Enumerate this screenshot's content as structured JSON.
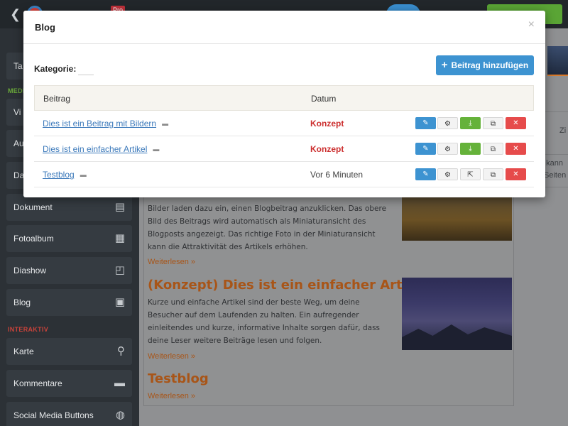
{
  "modal": {
    "title": "Blog",
    "close_glyph": "×",
    "category_label": "Kategorie:",
    "add_button": {
      "icon": "plus-icon",
      "label": "Beitrag hinzufügen"
    },
    "table": {
      "headers": [
        "Beitrag",
        "Datum"
      ],
      "rows": [
        {
          "title": "Dies ist ein Beitrag mit Bildern",
          "date": "Konzept",
          "status": "draft",
          "third_action": "publish-icon"
        },
        {
          "title": "Dies ist ein einfacher Artikel",
          "date": "Konzept",
          "status": "draft",
          "third_action": "publish-icon"
        },
        {
          "title": "Testblog",
          "date": "Vor 6 Minuten",
          "status": "published",
          "third_action": "external-link-icon"
        }
      ]
    }
  },
  "background": {
    "sidebar": {
      "sections": [
        "MEDIEN",
        "INTERAKTIV"
      ],
      "items": [
        "Ta",
        "Vi",
        "Au",
        "Da",
        "Dokument",
        "Fotoalbum",
        "Diashow",
        "Blog",
        "Karte",
        "Kommentare",
        "Social Media Buttons"
      ]
    },
    "blog_page": {
      "paragraph_1": "Bilder laden dazu ein, einen Blogbeitrag anzuklicken. Das obere Bild des Beitrags wird automatisch als Miniaturansicht des Blogposts angezeigt. Das richtige Foto in der Miniaturansicht kann die Attraktivität des Artikels erhöhen.",
      "read_more": "Weiterlesen »",
      "heading_2": "(Konzept) Dies ist ein einfacher Artikel",
      "paragraph_2": "Kurze und einfache Artikel sind der beste Weg, um deine Besucher auf dem Laufenden zu halten. Ein aufregender einleitendes und kurze, informative Inhalte sorgen dafür, dass deine Leser weitere Beiträge lesen und folgen.",
      "heading_3": "Testblog"
    },
    "right_panel": [
      "Zi",
      "u kann",
      "Seiten"
    ]
  },
  "colors": {
    "primary": "#3d93d1",
    "danger": "#e64b4b",
    "success": "#65b23a",
    "draft_text": "#cc2f2f",
    "accent_orange": "#a85518"
  }
}
